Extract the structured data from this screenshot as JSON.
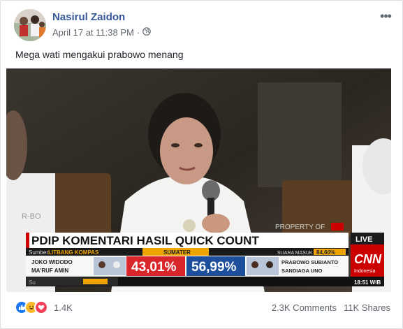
{
  "post": {
    "author": "Nasirul Zaidon",
    "time": "April 17 at 11:38 PM",
    "privacy_icon": "globe-icon",
    "text": "Mega wati mengakui prabowo menang"
  },
  "video": {
    "watermark": "R-BO",
    "property_tag": "PROPERTY OF",
    "headline": "PDIP KOMENTARI HASIL QUICK COUNT",
    "source_label": "Sumber:",
    "source": "LITBANG KOMPAS",
    "region": "SUMATER",
    "votes_label": "SUARA MASUK",
    "votes_pct": "84,60%",
    "candidate_left_1": "JOKO WIDODO",
    "candidate_left_2": "MA'RUF AMIN",
    "pct_left": "43,01%",
    "pct_right": "56,99%",
    "candidate_right_1": "PRABOWO SUBIANTO",
    "candidate_right_2": "SANDIAGA UNO",
    "live": "LIVE",
    "cnn": "CNN",
    "cnn_sub": "Indonesia",
    "clock": "18:51 WIB",
    "ticker_left": "Su"
  },
  "footer": {
    "reaction_count": "1.4K",
    "comments": "2.3K Comments",
    "shares": "11K Shares"
  },
  "colors": {
    "link": "#385898",
    "left_bar": "#d9262a",
    "right_bar": "#1d4f9c",
    "gold": "#f0a400"
  }
}
